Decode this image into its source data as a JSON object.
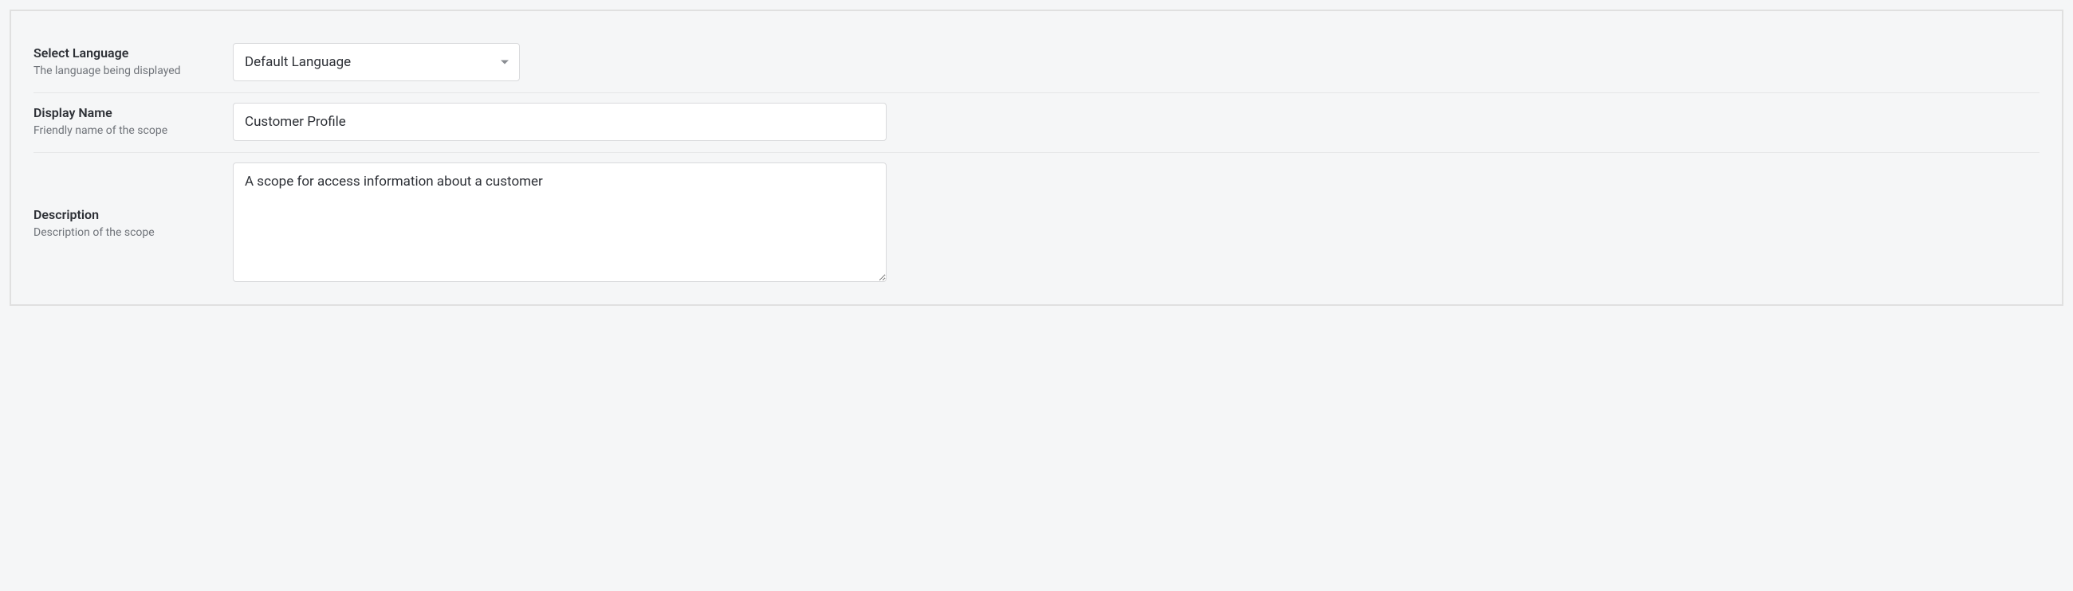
{
  "form": {
    "language": {
      "label": "Select Language",
      "sublabel": "The language being displayed",
      "selected": "Default Language"
    },
    "displayName": {
      "label": "Display Name",
      "sublabel": "Friendly name of the scope",
      "value": "Customer Profile"
    },
    "description": {
      "label": "Description",
      "sublabel": "Description of the scope",
      "value": "A scope for access information about a customer"
    }
  }
}
